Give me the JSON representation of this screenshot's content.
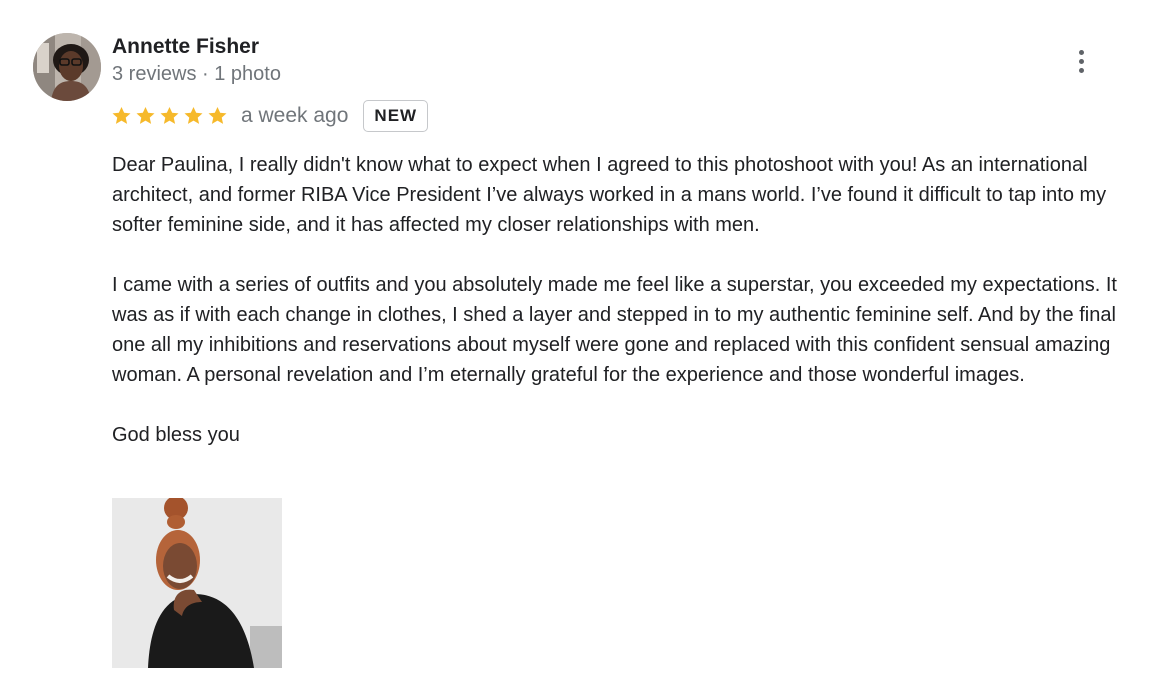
{
  "review": {
    "author": {
      "name": "Annette Fisher",
      "meta": "3 reviews · 1 photo"
    },
    "rating": 5,
    "date": "a week ago",
    "badge": "NEW",
    "paragraphs": [
      "Dear Paulina, I really didn't know what to expect when I agreed to this photoshoot with you! As an international architect, and former RIBA Vice President I’ve always worked in a mans world. I’ve found it difficult to tap into my softer feminine side, and it has affected my closer relationships with men.",
      "I came with a series of outfits and you absolutely made me feel like a superstar, you exceeded my expectations. It was as if with each change in clothes, I shed a layer and stepped in to my authentic feminine self. And by the final one all my inhibitions and reservations about myself were gone and replaced with this confident sensual amazing woman. A personal revelation and I’m eternally grateful for the experience and those wonderful images.",
      "God bless you"
    ],
    "icons": {
      "more": "more-vert-icon",
      "star": "star-icon"
    }
  },
  "colors": {
    "star": "#f6b92b",
    "text": "#202124",
    "secondary": "#70757a",
    "badge_border": "#c6c8cb"
  }
}
